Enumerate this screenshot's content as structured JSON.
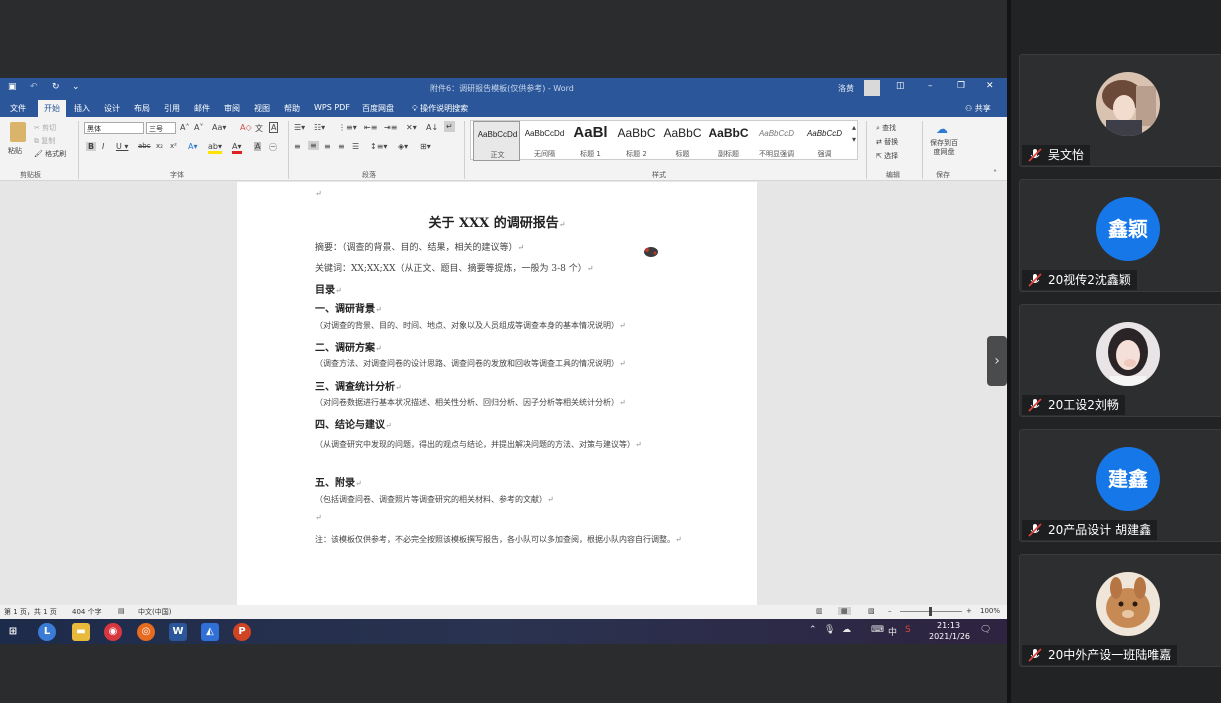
{
  "word": {
    "document_title": "附件6：调研报告模板(仅供参考) - Word",
    "user_name": "洛黄",
    "menu_tabs": [
      "文件",
      "开始",
      "插入",
      "设计",
      "布局",
      "引用",
      "邮件",
      "审阅",
      "视图",
      "帮助",
      "WPS PDF",
      "百度网盘"
    ],
    "active_tab": "开始",
    "search_hint": "操作说明搜索",
    "share_label": "共享",
    "ribbon": {
      "paste": "粘贴",
      "cut": "剪切",
      "copy": "复制",
      "format_painter": "格式刷",
      "font_name": "黑体",
      "font_size": "三号",
      "styles": [
        {
          "sample": "AaBbCcDd",
          "name": "正文"
        },
        {
          "sample": "AaBbCcDd",
          "name": "无间隔"
        },
        {
          "sample": "AaBl",
          "name": "标题 1"
        },
        {
          "sample": "AaBbC",
          "name": "标题 2"
        },
        {
          "sample": "AaBbC",
          "name": "标题"
        },
        {
          "sample": "AaBbC",
          "name": "副标题"
        },
        {
          "sample": "AaBbCcD",
          "name": "不明显强调"
        },
        {
          "sample": "AaBbCcD",
          "name": "强调"
        }
      ],
      "find": "查找",
      "replace": "替换",
      "select": "选择",
      "save_to_baidu": "保存到百度网盘",
      "group_labels": [
        "剪贴板",
        "字体",
        "段落",
        "样式",
        "编辑",
        "保存"
      ]
    },
    "document": {
      "title": "关于 XXX 的调研报告",
      "abstract": "摘要：（调查的背景、目的、结果，相关的建议等）",
      "keywords": "关键词：XX;XX;XX（从正文、题目、摘要等提炼，一般为 3-8 个）",
      "toc": "目录",
      "sections": [
        {
          "heading": "一、调研背景",
          "body": "（对调查的背景、目的、时间、地点、对象以及人员组成等调查本身的基本情况说明）"
        },
        {
          "heading": "二、调研方案",
          "body": "（调查方法、对调查问卷的设计思路、调查问卷的发放和回收等调查工具的情况说明）"
        },
        {
          "heading": "三、调查统计分析",
          "body": "（对问卷数据进行基本状况描述、相关性分析、回归分析、因子分析等相关统计分析）"
        },
        {
          "heading": "四、结论与建议",
          "body": "（从调查研究中发现的问题，得出的观点与结论，并提出解决问题的方法、对策与建议等）"
        },
        {
          "heading": "五、附录",
          "body": "（包括调查问卷、调查照片等调查研究的相关材料、参考的文献）"
        }
      ],
      "note": "注：该模板仅供参考，不必完全按照该模板撰写报告，各小队可以多加查阅，根据小队内容自行调整。"
    },
    "status": {
      "page": "第 1 页，共 1 页",
      "words": "404 个字",
      "language": "中文(中国)",
      "zoom": "100%"
    }
  },
  "taskbar": {
    "time": "21:13",
    "date": "2021/1/26",
    "ime": "中",
    "apps": [
      "start",
      "L",
      "file-explorer",
      "netease-music",
      "firefox",
      "word",
      "tencent-meeting",
      "powerpoint"
    ]
  },
  "participants": [
    {
      "name": "吴文怡",
      "avatar_text": ""
    },
    {
      "name": "20视传2沈鑫颖",
      "avatar_text": "鑫颖"
    },
    {
      "name": "20工设2刘畅",
      "avatar_text": ""
    },
    {
      "name": "20产品设计  胡建鑫",
      "avatar_text": "建鑫"
    },
    {
      "name": "20中外产设一班陆唯嘉",
      "avatar_text": ""
    }
  ],
  "colors": {
    "word_blue": "#2b579a",
    "avatar_blue": "#1677e8",
    "mic_muted": "#e0443a"
  }
}
